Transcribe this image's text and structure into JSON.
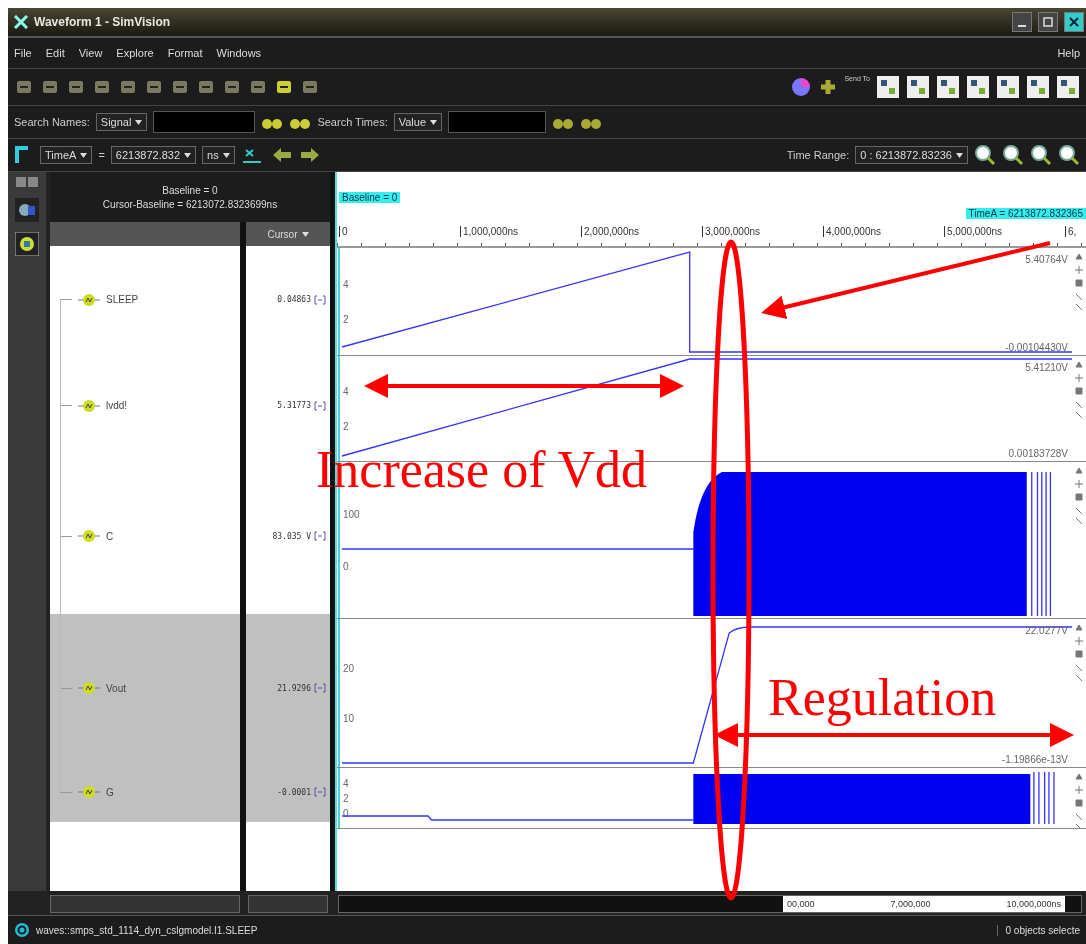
{
  "window": {
    "title": "Waveform 1 - SimVision"
  },
  "menu": [
    "File",
    "Edit",
    "View",
    "Explore",
    "Format",
    "Windows"
  ],
  "help_menu": "Help",
  "toolbar": {
    "send_to_label": "Send To"
  },
  "search": {
    "names_label": "Search Names:",
    "names_mode": "Signal",
    "times_label": "Search Times:",
    "times_mode": "Value"
  },
  "time_bar": {
    "cursor": "TimeA",
    "operator": "=",
    "time_value": "6213872.832",
    "unit": "ns",
    "range_label": "Time Range:",
    "range_value": "0 : 6213872.83236"
  },
  "names_panel": {
    "baseline": "Baseline = 0",
    "cursor_baseline": "Cursor-Baseline = 6213072.8323699ns",
    "value_column": "Cursor"
  },
  "markers": {
    "baseline": "Baseline = 0",
    "cursor": "TimeA = 6213872.832365"
  },
  "ruler": [
    "0",
    "1,000,000ns",
    "2,000,000ns",
    "3,000,000ns",
    "4,000,000ns",
    "5,000,000ns",
    "6,"
  ],
  "signals": [
    {
      "name": "SLEEP",
      "value": "0.04863",
      "selected": false,
      "kind": "ramp-drop",
      "y_ticks": [
        "4",
        "2"
      ],
      "max": "5.40764V",
      "min": "-0.00104430V"
    },
    {
      "name": "lvdd!",
      "value": "5.31773",
      "selected": false,
      "kind": "ramp-hold",
      "y_ticks": [
        "4",
        "2"
      ],
      "max": "5.41210V",
      "min": "0.00183728V"
    },
    {
      "name": "C",
      "value": "83.035 V",
      "selected": false,
      "kind": "burst",
      "y_ticks": [
        "100",
        "0"
      ]
    },
    {
      "name": "Vout",
      "value": "21.9296",
      "selected": true,
      "kind": "step-rise",
      "y_ticks": [
        "20",
        "10"
      ],
      "max": "22.0277V",
      "min": "-1.19866e-13V"
    },
    {
      "name": "G",
      "value": "-0.0001",
      "selected": true,
      "kind": "digital-burst",
      "y_ticks": [
        "4",
        "2",
        "0"
      ]
    }
  ],
  "overview": [
    "00,000",
    "7,000,000",
    "10,000,000ns"
  ],
  "status": {
    "path": "waves::smps_std_1114_dyn_cslgmodel.I1.SLEEP",
    "selection": "0 objects selecte"
  },
  "annotations": {
    "increase_label": "Increase of Vdd",
    "regulation_label": "Regulation"
  }
}
